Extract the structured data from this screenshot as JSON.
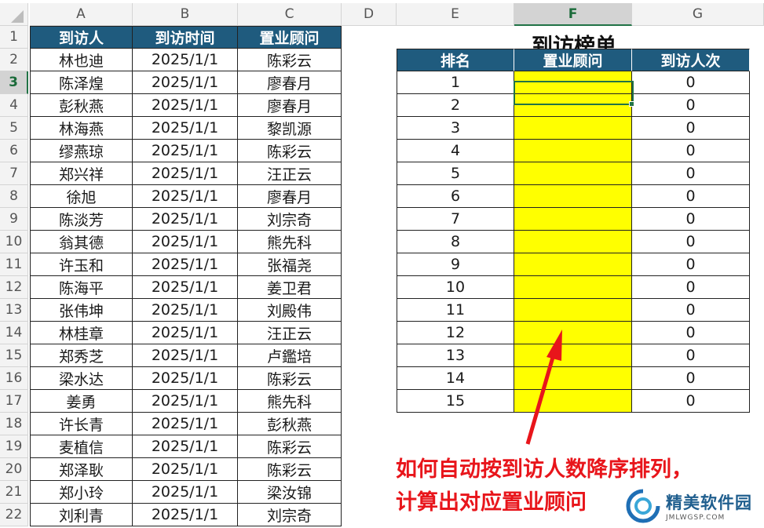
{
  "columns": [
    "A",
    "B",
    "C",
    "D",
    "E",
    "F",
    "G"
  ],
  "rows": [
    "1",
    "2",
    "3",
    "4",
    "5",
    "6",
    "7",
    "8",
    "9",
    "10",
    "11",
    "12",
    "13",
    "14",
    "15",
    "16",
    "17",
    "18",
    "19",
    "20",
    "21",
    "22"
  ],
  "left_table": {
    "headers": [
      "到访人",
      "到访时间",
      "置业顾问"
    ],
    "rows": [
      [
        "林也迪",
        "2025/1/1",
        "陈彩云"
      ],
      [
        "陈泽煌",
        "2025/1/1",
        "廖春月"
      ],
      [
        "彭秋燕",
        "2025/1/1",
        "廖春月"
      ],
      [
        "林海燕",
        "2025/1/1",
        "黎凯源"
      ],
      [
        "缪燕琼",
        "2025/1/1",
        "陈彩云"
      ],
      [
        "郑兴祥",
        "2025/1/1",
        "汪正云"
      ],
      [
        "徐旭",
        "2025/1/1",
        "廖春月"
      ],
      [
        "陈淡芳",
        "2025/1/1",
        "刘宗奇"
      ],
      [
        "翁其德",
        "2025/1/1",
        "熊先科"
      ],
      [
        "许玉和",
        "2025/1/1",
        "张福尧"
      ],
      [
        "陈海平",
        "2025/1/1",
        "姜卫君"
      ],
      [
        "张伟坤",
        "2025/1/1",
        "刘殿伟"
      ],
      [
        "林桂章",
        "2025/1/1",
        "汪正云"
      ],
      [
        "郑秀芝",
        "2025/1/1",
        "卢鑑培"
      ],
      [
        "梁水达",
        "2025/1/1",
        "陈彩云"
      ],
      [
        "姜勇",
        "2025/1/1",
        "熊先科"
      ],
      [
        "许长青",
        "2025/1/1",
        "彭秋燕"
      ],
      [
        "麦植信",
        "2025/1/1",
        "陈彩云"
      ],
      [
        "郑泽耿",
        "2025/1/1",
        "陈彩云"
      ],
      [
        "郑小玲",
        "2025/1/1",
        "梁汝锦"
      ],
      [
        "刘利青",
        "2025/1/1",
        "刘宗奇"
      ]
    ]
  },
  "right_table": {
    "title": "到访榜单",
    "headers": [
      "排名",
      "置业顾问",
      "到访人次"
    ],
    "rows": [
      [
        "1",
        "",
        "0"
      ],
      [
        "2",
        "",
        "0"
      ],
      [
        "3",
        "",
        "0"
      ],
      [
        "4",
        "",
        "0"
      ],
      [
        "5",
        "",
        "0"
      ],
      [
        "6",
        "",
        "0"
      ],
      [
        "7",
        "",
        "0"
      ],
      [
        "8",
        "",
        "0"
      ],
      [
        "9",
        "",
        "0"
      ],
      [
        "10",
        "",
        "0"
      ],
      [
        "11",
        "",
        "0"
      ],
      [
        "12",
        "",
        "0"
      ],
      [
        "13",
        "",
        "0"
      ],
      [
        "14",
        "",
        "0"
      ],
      [
        "15",
        "",
        "0"
      ]
    ]
  },
  "selection": {
    "column": "F",
    "row": "3"
  },
  "annotation": {
    "line1": "如何自动按到访人数降序排列，",
    "line2": "计算出对应置业顾问"
  },
  "watermark": {
    "text": "精美软件园",
    "sub": "JMLWGSP.COM"
  },
  "colors": {
    "header_bg": "#1f5b7e",
    "highlight": "#ffff00",
    "annotation": "#e8151b",
    "selection": "#217346"
  }
}
